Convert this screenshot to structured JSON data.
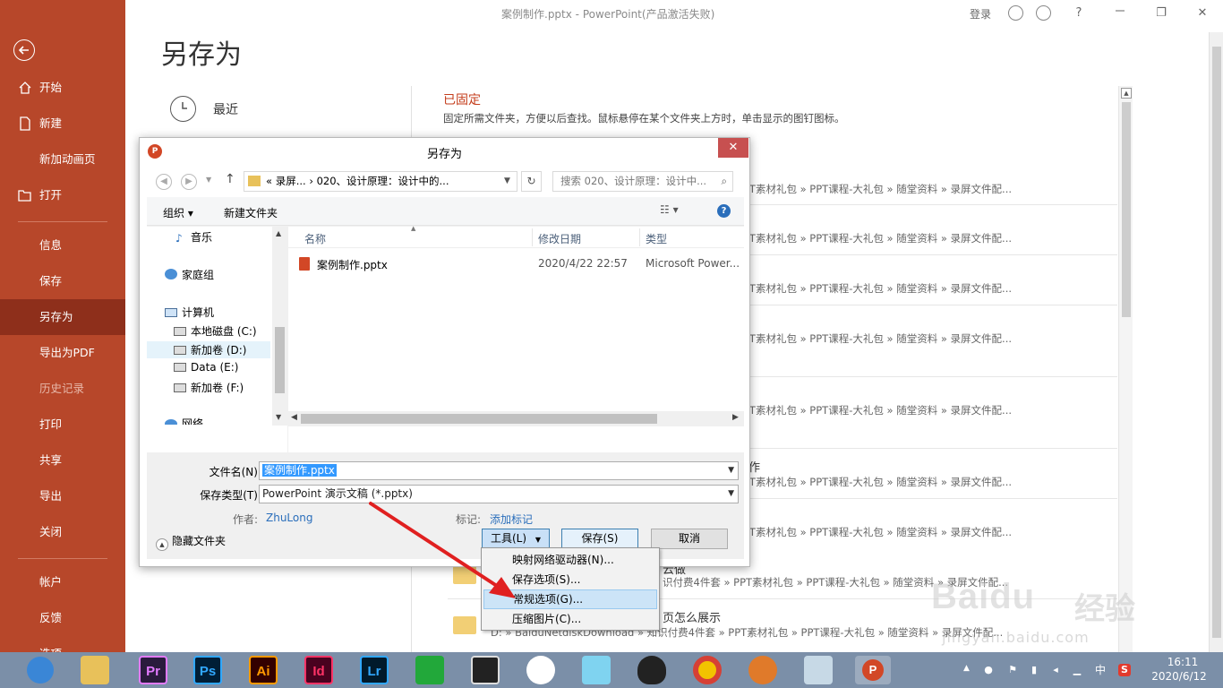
{
  "window": {
    "title": "案例制作.pptx  -  PowerPoint(产品激活失败)",
    "login": "登录",
    "help": "?",
    "restore": "❐",
    "close": "✕"
  },
  "sidebar": {
    "items": [
      {
        "label": "开始"
      },
      {
        "label": "新建"
      },
      {
        "label": "新加动画页"
      },
      {
        "label": "打开"
      },
      {
        "label": "信息"
      },
      {
        "label": "保存"
      },
      {
        "label": "另存为"
      },
      {
        "label": "导出为PDF"
      },
      {
        "label": "历史记录"
      },
      {
        "label": "打印"
      },
      {
        "label": "共享"
      },
      {
        "label": "导出"
      },
      {
        "label": "关闭"
      },
      {
        "label": "帐户"
      },
      {
        "label": "反馈"
      },
      {
        "label": "选项"
      }
    ]
  },
  "main": {
    "title": "另存为",
    "recent_label": "最近",
    "pinned_title": "已固定",
    "pinned_desc": "固定所需文件夹，方便以后查找。鼠标悬停在某个文件夹上方时，单击显示的图钉图标。",
    "path_rows": [
      "PT素材礼包 » PPT课程-大礼包 » 随堂资料 » 录屏文件配...",
      "PT素材礼包 » PPT课程-大礼包 » 随堂资料 » 录屏文件配...",
      "PT素材礼包 » PPT课程-大礼包 » 随堂资料 » 录屏文件配...",
      "PT素材礼包 » PPT课程-大礼包 » 随堂资料 » 录屏文件配...",
      "PT素材礼包 » PPT课程-大礼包 » 随堂资料 » 录屏文件配...",
      "PT素材礼包 » PPT课程-大礼包 » 随堂资料 » 录屏文件配...",
      "PT素材礼包 » PPT课程-大礼包 » 随堂资料 » 录屏文件配...",
      "识付费4件套 » PPT素材礼包 » PPT课程-大礼包 » 随堂资料 » 录屏文件配...",
      "D: » BaiduNetdiskDownload » 知识付费4件套 » PPT素材礼包 » PPT课程-大礼包 » 随堂资料 » 录屏文件配..."
    ],
    "extra_1": "作",
    "extra_2": "云做",
    "extra_3": "页怎么展示"
  },
  "dialog": {
    "title": "另存为",
    "close": "✕",
    "address": "«  录屏...  ›  020、设计原理：设计中的...",
    "search_placeholder": "搜索 020、设计原理：设计中...",
    "organize": "组织 ▾",
    "new_folder": "新建文件夹",
    "help": "?",
    "tree": [
      {
        "label": "音乐"
      },
      {
        "label": "家庭组"
      },
      {
        "label": "计算机"
      },
      {
        "label": "本地磁盘 (C:)"
      },
      {
        "label": "新加卷 (D:)"
      },
      {
        "label": "Data (E:)"
      },
      {
        "label": "新加卷 (F:)"
      },
      {
        "label": "网络"
      }
    ],
    "columns": {
      "name": "名称",
      "date": "修改日期",
      "type": "类型"
    },
    "file": {
      "name": "案例制作.pptx",
      "date": "2020/4/22 22:57",
      "type": "Microsoft Power..."
    },
    "filename_label": "文件名(N):",
    "filename_value": "案例制作.pptx",
    "filetype_label": "保存类型(T):",
    "filetype_value": "PowerPoint 演示文稿 (*.pptx)",
    "author_label": "作者:",
    "author_value": "ZhuLong",
    "tags_label": "标记:",
    "tags_value": "添加标记",
    "hide_folders": "隐藏文件夹",
    "tools": "工具(L)",
    "save": "保存(S)",
    "cancel": "取消"
  },
  "tools_menu": {
    "items": [
      {
        "label": "映射网络驱动器(N)..."
      },
      {
        "label": "保存选项(S)..."
      },
      {
        "label": "常规选项(G)..."
      },
      {
        "label": "压缩图片(C)..."
      }
    ],
    "highlighted": 2
  },
  "watermark": {
    "brand": "Baidu",
    "brand_cn": "经验",
    "url": "jingyan.baidu.com"
  },
  "taskbar": {
    "apps": [
      {
        "label": "Pr",
        "color": "#2a1b3d",
        "fg": "#e37bff"
      },
      {
        "label": "Ps",
        "color": "#001e36",
        "fg": "#31a8ff"
      },
      {
        "label": "Ai",
        "color": "#330000",
        "fg": "#ff9a00"
      },
      {
        "label": "Id",
        "color": "#49021f",
        "fg": "#ff3366"
      },
      {
        "label": "Lr",
        "color": "#001a2b",
        "fg": "#31a8ff"
      }
    ],
    "ime": "中",
    "time": "16:11",
    "date": "2020/6/12"
  }
}
